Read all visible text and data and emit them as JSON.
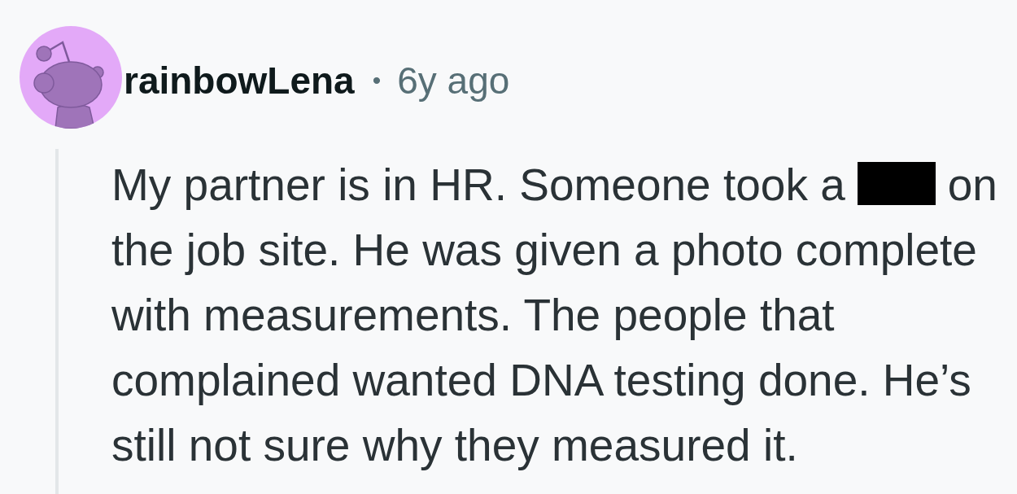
{
  "comment": {
    "author": "rainbowLena",
    "separator": "•",
    "age": "6y ago",
    "body": {
      "first_line": [
        {
          "kind": "text",
          "text": "My partner is in HR. Someone took a"
        },
        {
          "kind": "redacted"
        },
        {
          "kind": "text",
          "text": "on"
        }
      ],
      "continuation": "the job site. He was given a photo complete with measurements. The people that complained wanted DNA testing done. He’s still not sure why they measured it."
    }
  }
}
